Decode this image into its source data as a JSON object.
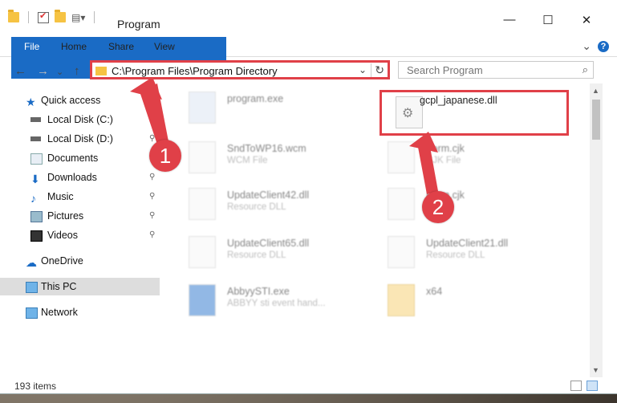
{
  "window": {
    "title": "Program",
    "controls": {
      "minimize": "—",
      "maximize": "☐",
      "close": "✕"
    }
  },
  "ribbon": {
    "tabs": [
      "File",
      "Home",
      "Share",
      "View"
    ],
    "expand": "⌄",
    "help": "?"
  },
  "nav": {
    "back": "←",
    "forward": "→",
    "recent": "⌄",
    "up": "↑",
    "address": "C:\\Program Files\\Program Directory",
    "search_placeholder": "Search Program"
  },
  "sidebar": {
    "items": [
      {
        "label": "Quick access",
        "icon": "star-icon",
        "pinned": false
      },
      {
        "label": "Local Disk (C:)",
        "icon": "drive-icon",
        "pinned": false
      },
      {
        "label": "Local Disk (D:)",
        "icon": "drive-icon",
        "pinned": true
      },
      {
        "label": "Documents",
        "icon": "documents-icon",
        "pinned": true
      },
      {
        "label": "Downloads",
        "icon": "download-icon",
        "pinned": true
      },
      {
        "label": "Music",
        "icon": "music-icon",
        "pinned": true
      },
      {
        "label": "Pictures",
        "icon": "pictures-icon",
        "pinned": true
      },
      {
        "label": "Videos",
        "icon": "videos-icon",
        "pinned": true
      },
      {
        "label": "OneDrive",
        "icon": "cloud-icon",
        "pinned": false
      },
      {
        "label": "This PC",
        "icon": "computer-icon",
        "pinned": false
      },
      {
        "label": "Network",
        "icon": "network-icon",
        "pinned": false
      }
    ],
    "pin_glyph": "📌"
  },
  "files": [
    {
      "name": "program.exe",
      "type": "",
      "icon": "exe-icon"
    },
    {
      "name": "gcpl_japanese.dll",
      "type": "",
      "icon": "dll-gear-icon"
    },
    {
      "name": "SndToWP16.wcm",
      "type": "WCM File",
      "icon": "file-icon"
    },
    {
      "name": "Form.cjk",
      "type": "CJK File",
      "icon": "file-icon"
    },
    {
      "name": "UpdateClient42.dll",
      "type": "Resource DLL",
      "icon": "dll-gear-icon"
    },
    {
      "name": "Form.cjk",
      "type": "",
      "icon": "file-icon"
    },
    {
      "name": "UpdateClient65.dll",
      "type": "Resource DLL",
      "icon": "dll-gear-icon"
    },
    {
      "name": "UpdateClient21.dll",
      "type": "Resource DLL",
      "icon": "dll-gear-icon"
    },
    {
      "name": "AbbyySTI.exe",
      "type": "ABBYY sti event hand...",
      "icon": "exe-icon"
    },
    {
      "name": "x64",
      "type": "",
      "icon": "folder-icon"
    }
  ],
  "status": {
    "item_count": "193 items"
  },
  "annotations": {
    "step1": "1",
    "step2": "2"
  },
  "colors": {
    "accent": "#1a6bc5",
    "highlight": "#e04048",
    "folder": "#f6c343"
  }
}
